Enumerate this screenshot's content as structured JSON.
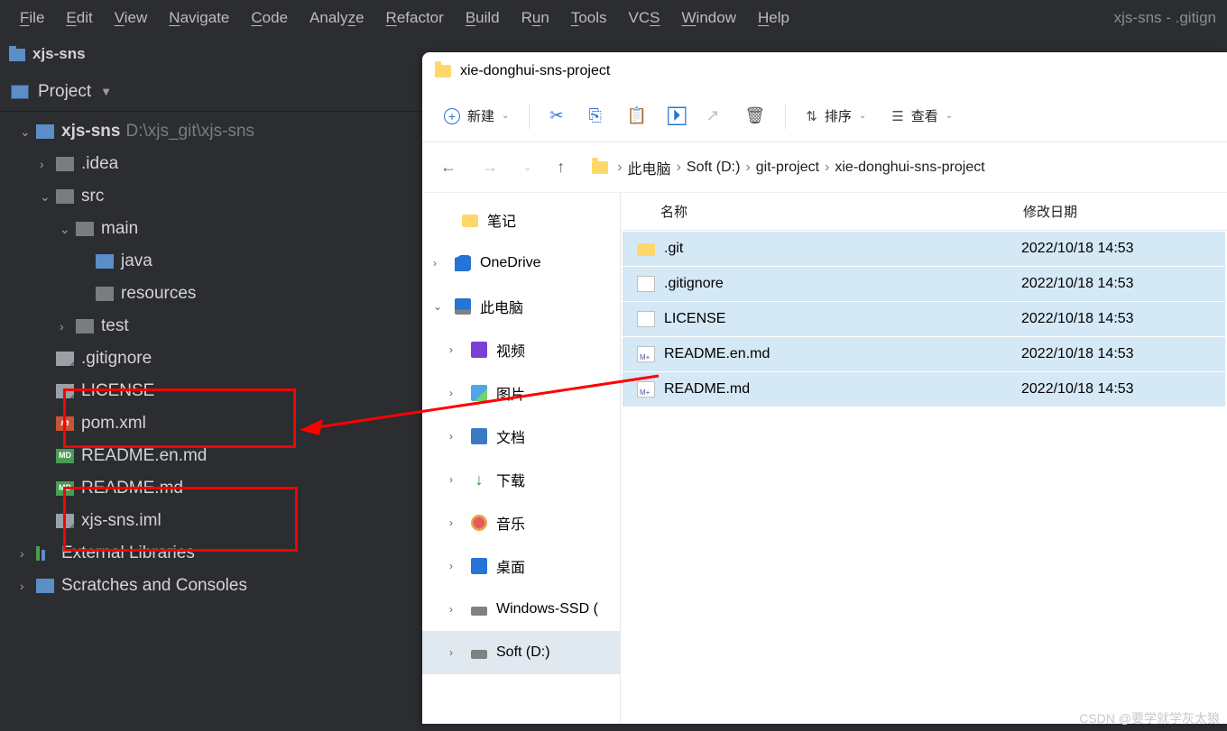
{
  "ide": {
    "menu": [
      {
        "label": "File",
        "u": "F"
      },
      {
        "label": "Edit",
        "u": "E"
      },
      {
        "label": "View",
        "u": "V"
      },
      {
        "label": "Navigate",
        "u": "N"
      },
      {
        "label": "Code",
        "u": "C"
      },
      {
        "label": "Analyze",
        "u": null
      },
      {
        "label": "Refactor",
        "u": "R"
      },
      {
        "label": "Build",
        "u": "B"
      },
      {
        "label": "Run",
        "u": "u"
      },
      {
        "label": "Tools",
        "u": "T"
      },
      {
        "label": "VCS",
        "u": "S"
      },
      {
        "label": "Window",
        "u": "W"
      },
      {
        "label": "Help",
        "u": "H"
      }
    ],
    "window_title": "xjs-sns - .gitign",
    "project_tab": "xjs-sns",
    "panel_title": "Project",
    "tree": {
      "root_name": "xjs-sns",
      "root_path": "D:\\xjs_git\\xjs-sns",
      "idea": ".idea",
      "src": "src",
      "main": "main",
      "java": "java",
      "resources": "resources",
      "test": "test",
      "gitignore": ".gitignore",
      "license": "LICENSE",
      "pom": "pom.xml",
      "readme_en": "README.en.md",
      "readme": "README.md",
      "iml": "xjs-sns.iml",
      "ext_lib": "External Libraries",
      "scratches": "Scratches and Consoles"
    }
  },
  "explorer": {
    "title": "xie-donghui-sns-project",
    "toolbar": {
      "new": "新建",
      "sort": "排序",
      "view": "查看"
    },
    "breadcrumb": [
      "此电脑",
      "Soft (D:)",
      "git-project",
      "xie-donghui-sns-project"
    ],
    "sidebar": {
      "notes": "笔记",
      "onedrive": "OneDrive",
      "pc": "此电脑",
      "video": "视频",
      "images": "图片",
      "docs": "文档",
      "downloads": "下载",
      "music": "音乐",
      "desktop": "桌面",
      "win_ssd": "Windows-SSD (",
      "soft_d": "Soft (D:)"
    },
    "columns": {
      "name": "名称",
      "date": "修改日期"
    },
    "files": [
      {
        "name": ".git",
        "type": "folder",
        "date": "2022/10/18 14:53"
      },
      {
        "name": ".gitignore",
        "type": "txt",
        "date": "2022/10/18 14:53"
      },
      {
        "name": "LICENSE",
        "type": "txt",
        "date": "2022/10/18 14:53"
      },
      {
        "name": "README.en.md",
        "type": "md",
        "date": "2022/10/18 14:53"
      },
      {
        "name": "README.md",
        "type": "md",
        "date": "2022/10/18 14:53"
      }
    ]
  },
  "watermark": "CSDN @要学就学灰太狼"
}
